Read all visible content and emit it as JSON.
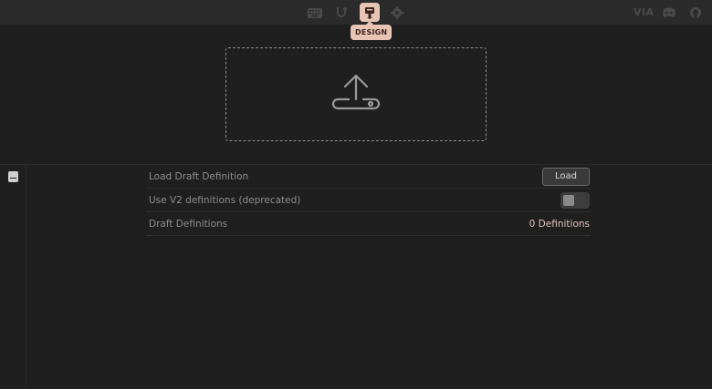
{
  "nav": {
    "items": [
      {
        "name": "keyboard-icon"
      },
      {
        "name": "test-icon"
      },
      {
        "name": "design-icon",
        "active": true
      },
      {
        "name": "settings-icon"
      }
    ],
    "tooltip": "DESIGN",
    "brand": "VIA"
  },
  "upload": {
    "icon": "upload-icon"
  },
  "sidebar": {
    "icon": "definitions-icon"
  },
  "rows": {
    "load_draft": {
      "label": "Load Draft Definition",
      "button": "Load"
    },
    "use_v2": {
      "label": "Use V2 definitions (deprecated)",
      "enabled": false
    },
    "draft_defs": {
      "label": "Draft Definitions",
      "value": "0 Definitions"
    }
  },
  "colors": {
    "accent": "#e8c4b4",
    "background": "#1f1f1f",
    "topbar": "#2b2b2b"
  }
}
